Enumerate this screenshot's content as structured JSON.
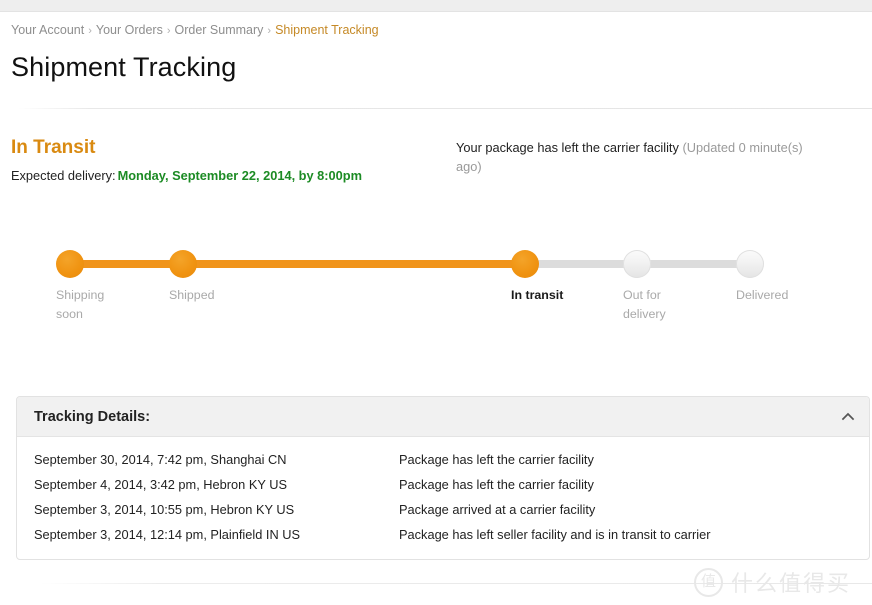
{
  "breadcrumb": {
    "separator": "›",
    "items": [
      {
        "label": "Your Account",
        "current": false
      },
      {
        "label": "Your Orders",
        "current": false
      },
      {
        "label": "Order Summary",
        "current": false
      },
      {
        "label": "Shipment Tracking",
        "current": true
      }
    ]
  },
  "page": {
    "title": "Shipment Tracking"
  },
  "status": {
    "state_label": "In Transit",
    "state_color": "#d98a11",
    "expected_label": "Expected delivery:",
    "expected_date": "Monday, September 22, 2014, by 8:00pm",
    "expected_color": "#1c8b24",
    "update_message": "Your package has left the carrier facility",
    "update_meta": "(Updated 0 minute(s) ago)"
  },
  "tracker": {
    "active_color": "#f0941b",
    "inactive_color": "#dcdcdc",
    "steps": [
      {
        "label": "Shipping soon",
        "state": "done",
        "current": false
      },
      {
        "label": "Shipped",
        "state": "done",
        "current": false
      },
      {
        "label": "In transit",
        "state": "done",
        "current": true
      },
      {
        "label": "Out for delivery",
        "state": "todo",
        "current": false
      },
      {
        "label": "Delivered",
        "state": "todo",
        "current": false
      }
    ]
  },
  "details_panel": {
    "header_title": "Tracking Details:",
    "collapse_icon": "chevron-up-icon",
    "rows": [
      {
        "when": "September 30, 2014, 7:42 pm, Shanghai CN",
        "what": "Package has left the carrier facility"
      },
      {
        "when": "September 4, 2014, 3:42 pm, Hebron KY US",
        "what": "Package has left the carrier facility"
      },
      {
        "when": "September 3, 2014, 10:55 pm, Hebron KY US",
        "what": "Package arrived at a carrier facility"
      },
      {
        "when": "September 3, 2014, 12:14 pm, Plainfield IN US",
        "what": "Package has left seller facility and is in transit to carrier"
      }
    ]
  },
  "watermark": {
    "mark": "值",
    "text": "什么值得买"
  }
}
